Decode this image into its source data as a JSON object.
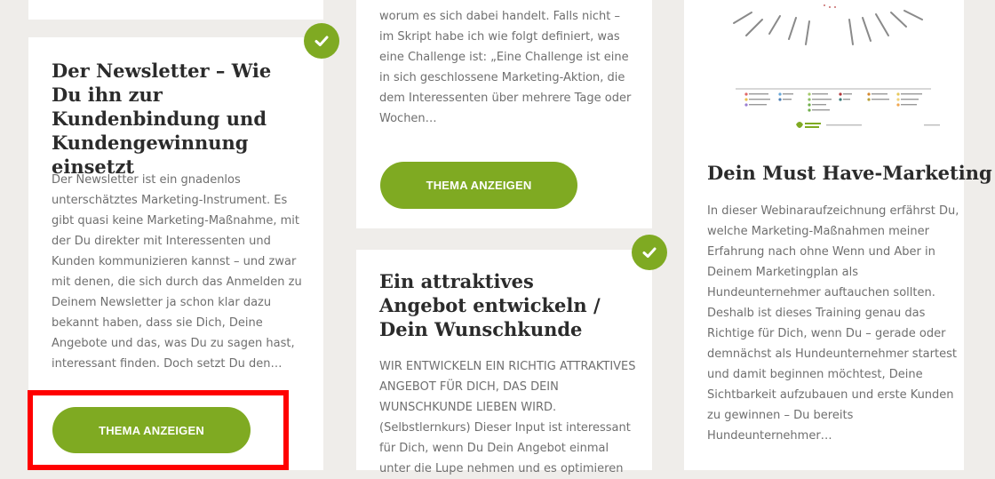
{
  "cards": [
    {
      "title": "Der Newsletter – Wie Du ihn zur Kundenbindung und Kundengewinnung einsetzt",
      "excerpt": "Der Newsletter ist ein gnadenlos unterschätztes Marketing-Instrument. Es gibt quasi keine Marketing-Maßnahme, mit der Du direkter mit Interessenten und Kunden kommunizieren kannst – und zwar mit denen, die sich durch das Anmelden zu Deinem Newsletter ja schon klar dazu bekannt haben, dass sie Dich, Deine Angebote und das, was Du zu sagen hast, interessant finden. Doch setzt Du den…",
      "button_label": "THEMA ANZEIGEN",
      "completed": true
    },
    {
      "excerpt": "worum es sich dabei handelt. Falls nicht – im Skript habe ich wie folgt definiert, was eine Challenge ist: „Eine Challenge ist eine in sich geschlossene Marketing-Aktion, die dem Interessenten über mehrere Tage oder Wochen…",
      "button_label": "THEMA ANZEIGEN"
    },
    {
      "title": "Ein attraktives Angebot entwickeln / Dein Wunschkunde",
      "excerpt": "WIR ENTWICKELN EIN RICHTIG ATTRAKTIVES ANGEBOT FÜR DICH, DAS DEIN WUNSCHKUNDE LIEBEN WIRD. (Selbstlernkurs) Dieser Input ist interessant für Dich, wenn Du Dein Angebot einmal unter die Lupe nehmen und es optimieren",
      "completed": true
    },
    {
      "title": "Dein Must Have-Marketing",
      "excerpt": "In dieser Webinaraufzeichnung erfährst Du, welche Marketing-Maßnahmen meiner Erfahrung nach ohne Wenn und Aber in Deinem Marketingplan als Hundeunternehmer auftauchen sollten. Deshalb ist dieses Training genau das Richtige für Dich, wenn Du – gerade oder demnächst als Hundeunternehmer startest und damit beginnen möchtest, Deine Sichtbarkeit aufzubauen und erste Kunden zu gewinnen – Du bereits Hundeunternehmer…"
    }
  ],
  "colors": {
    "accent": "#7faa22",
    "highlight": "#ff0000",
    "background": "#efedea"
  },
  "icons": {
    "check": "check-circle-icon"
  }
}
